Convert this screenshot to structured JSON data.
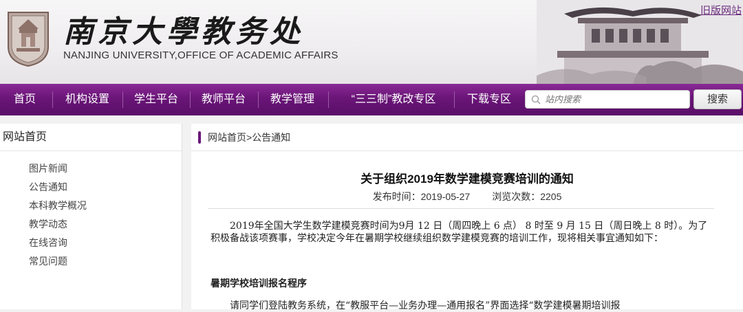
{
  "header": {
    "brand_cn": "南京大學教务处",
    "brand_en": "NANJING UNIVERSITY,OFFICE OF ACADEMIC AFFAIRS",
    "old_site_link": "旧版网站",
    "logo_icon": "university-seal-icon",
    "banner_image": "campus-building-illustration"
  },
  "nav": {
    "items": [
      {
        "label": "首页"
      },
      {
        "label": "机构设置"
      },
      {
        "label": "学生平台"
      },
      {
        "label": "教师平台"
      },
      {
        "label": "教学管理"
      },
      {
        "label": "“三三制”教改专区"
      },
      {
        "label": "下载专区"
      }
    ],
    "search": {
      "placeholder": "站内搜索",
      "icon": "search-icon",
      "button_label": "搜索"
    }
  },
  "sidebar": {
    "title": "网站首页",
    "items": [
      {
        "label": "图片新闻"
      },
      {
        "label": "公告通知"
      },
      {
        "label": "本科教学概况"
      },
      {
        "label": "教学动态"
      },
      {
        "label": "在线咨询"
      },
      {
        "label": "常见问题"
      }
    ]
  },
  "main": {
    "breadcrumb": {
      "home": "网站首页",
      "separator": ">",
      "current": "公告通知"
    },
    "article": {
      "title": "关于组织2019年数学建模竞赛培训的通知",
      "publish_time": "发布时间：2019-05-27",
      "view_count": "浏览次数：2205",
      "paragraph1": "2019年全国大学生数学建模竞赛时间为9月 12 日（周四晚上 6 点） 8 时至 9 月 15 日（周日晚上 8 时）。为了积极备战该项赛事，学校决定今年在暑期学校继续组织数学建模竞赛的培训工作，现将相关事宜通知如下：",
      "subheading": "暑期学校培训报名程序",
      "paragraph2": "请同学们登陆教务系统，在“教服平台—业务办理—通用报名”界面选择“数学建模暑期培训报"
    }
  },
  "colors": {
    "nav_purple": "#6a1578",
    "link_purple": "#6a2c7d"
  }
}
